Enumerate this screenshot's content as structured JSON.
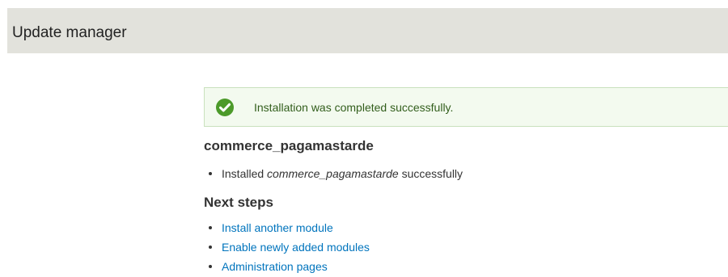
{
  "header": {
    "title": "Update manager"
  },
  "status_message": {
    "icon": "check-circle-icon",
    "text": "Installation was completed successfully.",
    "color": "#325e1c"
  },
  "module": {
    "name": "commerce_pagamastarde",
    "result": {
      "prefix": "Installed ",
      "module_name": "commerce_pagamastarde",
      "suffix": " successfully"
    }
  },
  "next_steps": {
    "heading": "Next steps",
    "links": [
      {
        "label": "Install another module"
      },
      {
        "label": "Enable newly added modules"
      },
      {
        "label": "Administration pages"
      }
    ]
  },
  "colors": {
    "header_bg": "#e2e2dc",
    "message_bg": "#f3faef",
    "message_border": "#c9e1bd",
    "success_icon": "#4c9a2a",
    "link": "#0074bd"
  }
}
